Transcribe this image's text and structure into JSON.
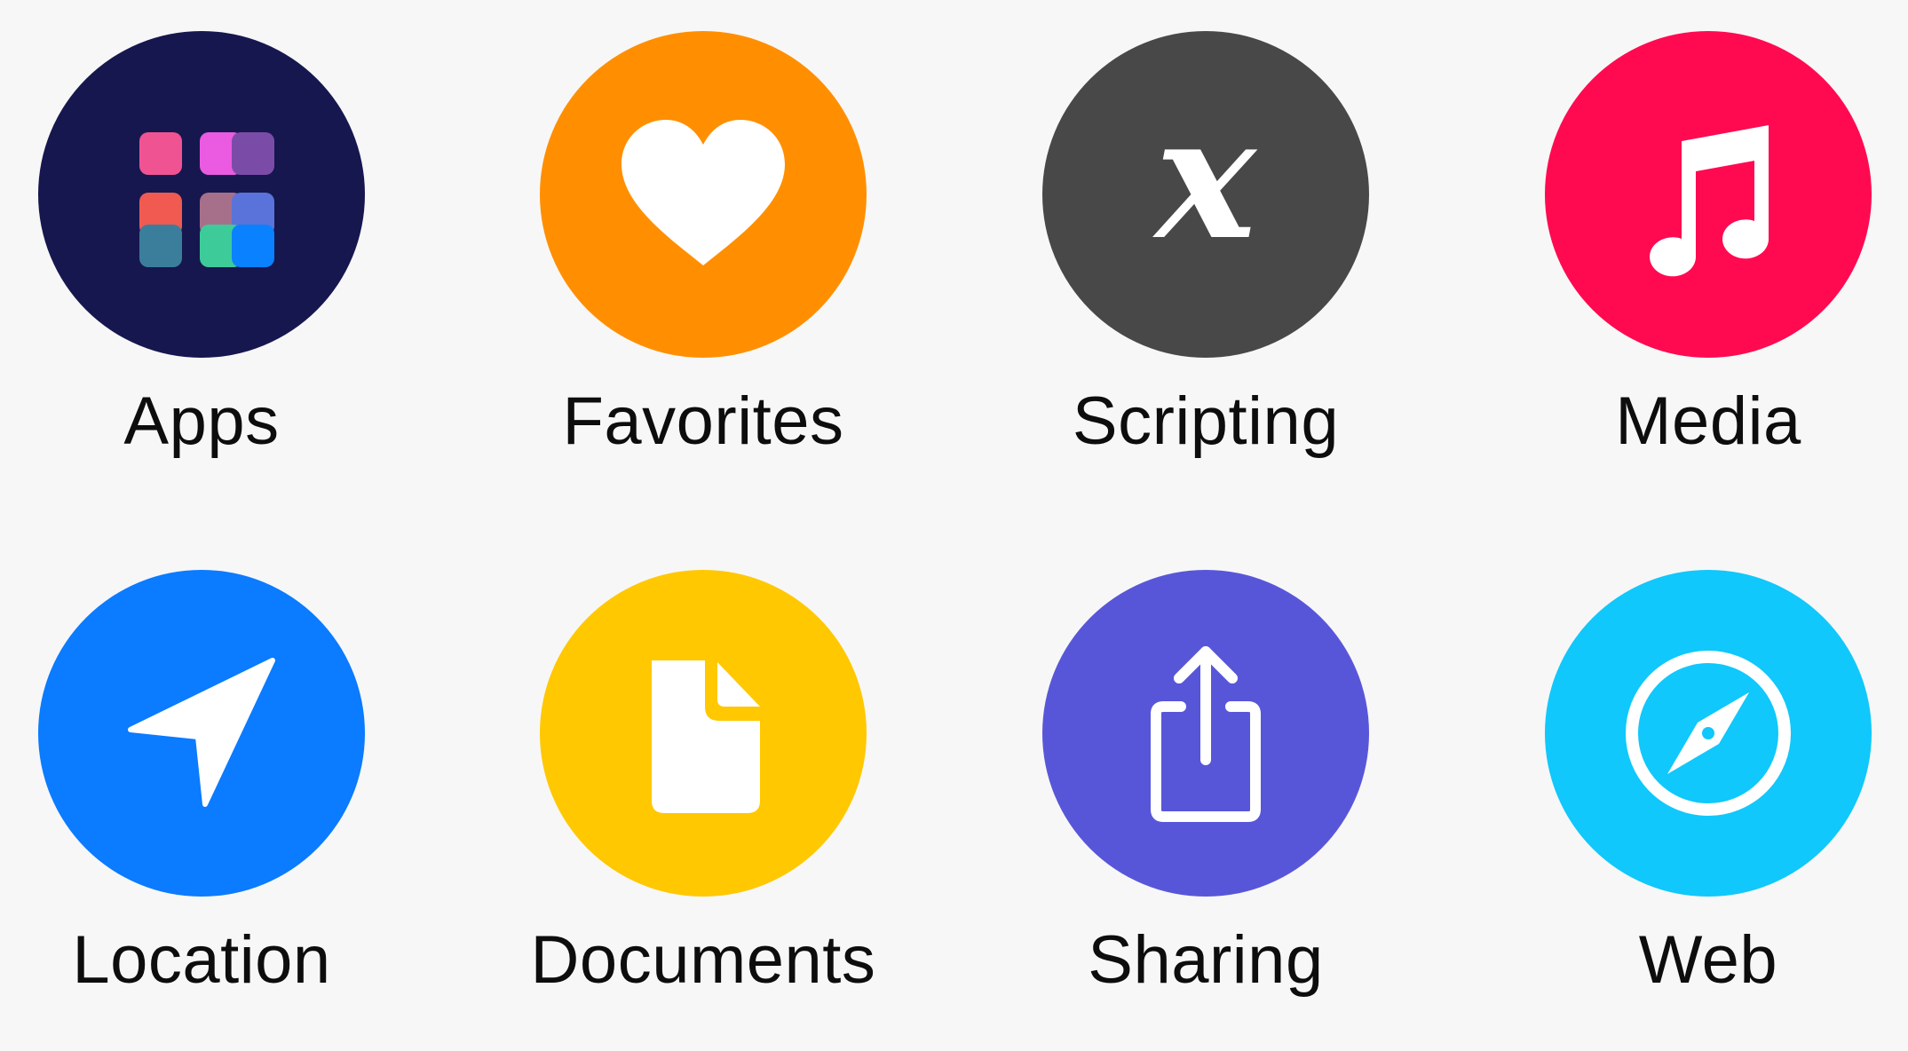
{
  "categories": [
    {
      "label": "Apps",
      "color": "#16174f",
      "icon": "apps-grid-icon"
    },
    {
      "label": "Favorites",
      "color": "#ff8f00",
      "icon": "heart-icon"
    },
    {
      "label": "Scripting",
      "color": "#484848",
      "icon": "variable-x-icon"
    },
    {
      "label": "Media",
      "color": "#ff0a50",
      "icon": "music-note-icon"
    },
    {
      "label": "Location",
      "color": "#0b7bff",
      "icon": "location-arrow-icon"
    },
    {
      "label": "Documents",
      "color": "#ffc800",
      "icon": "document-icon"
    },
    {
      "label": "Sharing",
      "color": "#5856d8",
      "icon": "share-icon"
    },
    {
      "label": "Web",
      "color": "#10c8fb",
      "icon": "compass-icon"
    }
  ],
  "apps_grid_colors": [
    "#f05392",
    "#ea5be1",
    "#7b4ca7",
    "#f05a51",
    "#a6708a",
    "#5a73da",
    "#3b7e9c",
    "#3dcb9a",
    "#0a81ff"
  ]
}
